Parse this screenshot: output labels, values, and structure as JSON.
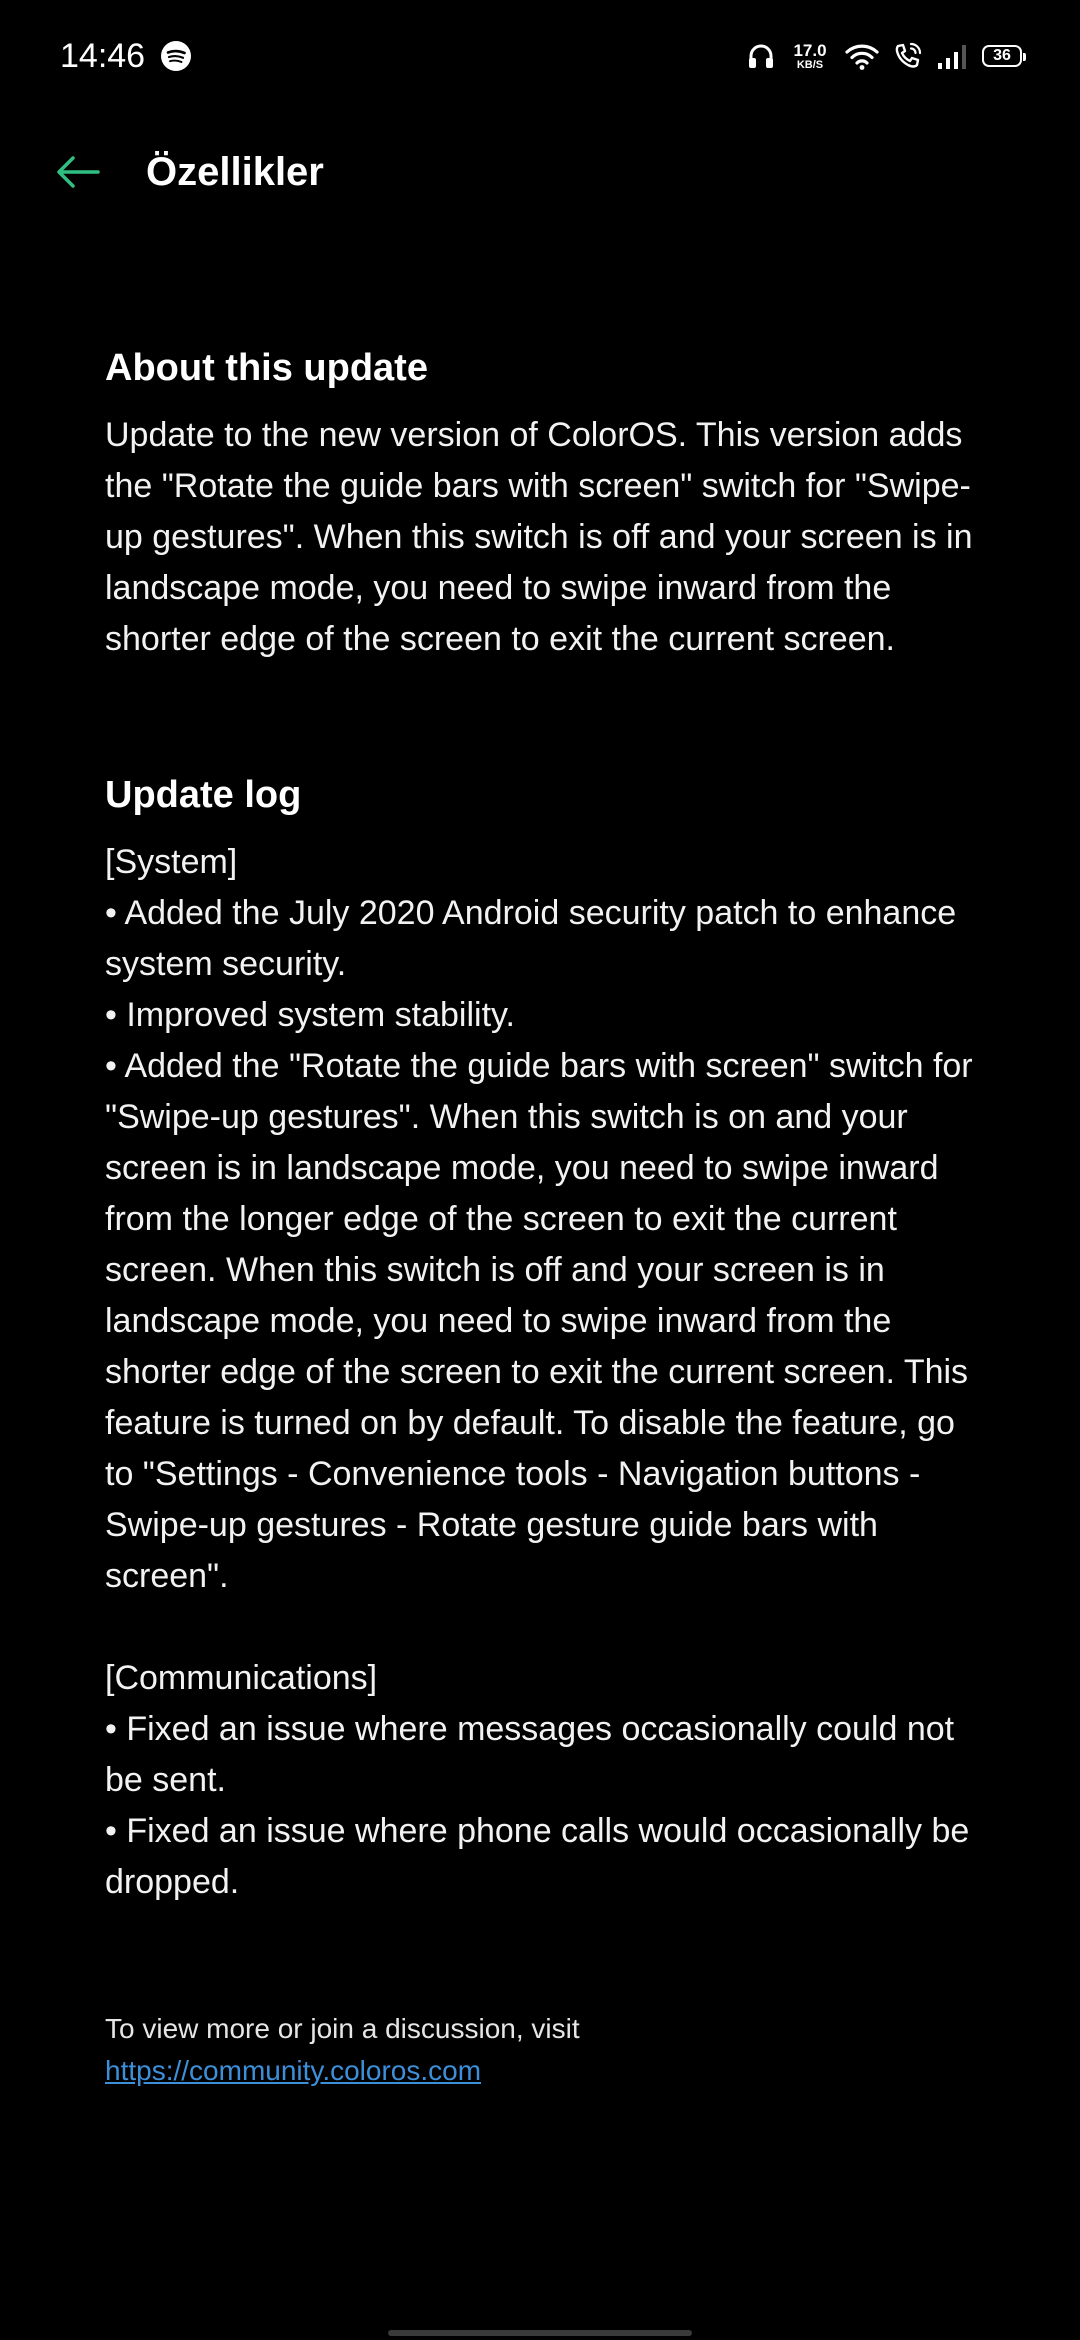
{
  "status_bar": {
    "time": "14:46",
    "speed_value": "17.0",
    "speed_unit": "KB/S",
    "battery": "36",
    "icons": [
      "spotify-icon",
      "headphones-icon",
      "wifi-icon",
      "wifi-calling-icon",
      "cellular-signal-icon",
      "battery-icon"
    ]
  },
  "app_bar": {
    "back_icon": "arrow-left-icon",
    "title": "Özellikler",
    "accent_color": "#2fbf83"
  },
  "about": {
    "title": "About this update",
    "body": "Update to the new version of ColorOS. This version adds the \"Rotate the guide bars with screen\" switch for \"Swipe-up gestures\". When this switch is off and your screen is in landscape mode, you need to swipe inward from the shorter edge of the screen to exit the current screen."
  },
  "update_log": {
    "title": "Update log",
    "system_heading": "[System]",
    "system_items": [
      "• Added the July 2020 Android security patch to enhance system security.",
      "• Improved system stability.",
      "• Added the \"Rotate the guide bars with screen\" switch for \"Swipe-up gestures\". When this switch is on and your screen is in landscape mode, you need to swipe inward from the longer edge of the screen to exit the current screen. When this switch is off and your screen is in landscape mode, you need to swipe inward from the shorter edge of the screen to exit the current screen. This feature is turned on by default. To disable the feature, go to \"Settings - Convenience tools - Navigation buttons - Swipe-up gestures - Rotate gesture guide bars with screen\"."
    ],
    "communications_heading": "[Communications]",
    "communications_items": [
      "• Fixed an issue where messages occasionally could not be sent.",
      "• Fixed an issue where phone calls would occasionally be dropped."
    ]
  },
  "footer": {
    "text": "To view more or join a discussion, visit",
    "link": "https://community.coloros.com",
    "link_color": "#3d8fd9"
  }
}
